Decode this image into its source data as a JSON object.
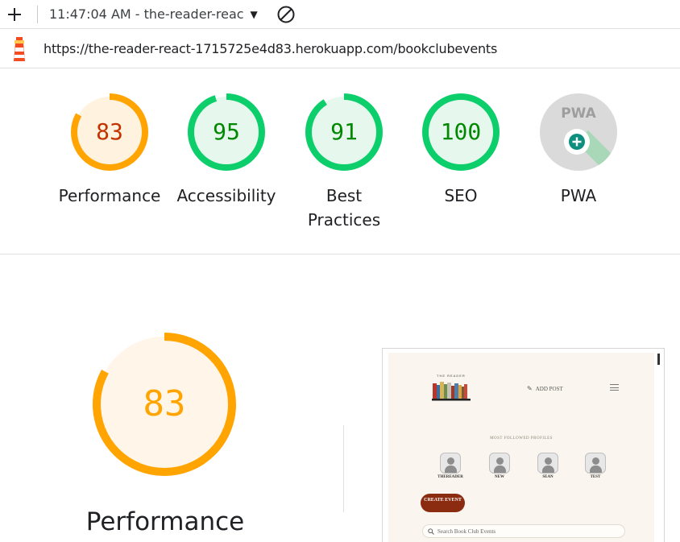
{
  "toolbar": {
    "report_title": "11:47:04 AM - the-reader-reac",
    "icons": {
      "new_report": "plus-icon",
      "dropdown": "caret-down-icon",
      "clear": "block-icon"
    }
  },
  "urlbar": {
    "url": "https://the-reader-react-1715725e4d83.herokuapp.com/bookclubevents",
    "logo_icon": "lighthouse-icon"
  },
  "scores": [
    {
      "id": "performance",
      "label": "Performance",
      "value": 83,
      "fraction": 0.83,
      "ring_color": "#ffa400",
      "bg_color": "#fff3e0",
      "text_color": "#c33300"
    },
    {
      "id": "accessibility",
      "label": "Accessibility",
      "value": 95,
      "fraction": 0.95,
      "ring_color": "#0cce6b",
      "bg_color": "#e6f8ee",
      "text_color": "#008800"
    },
    {
      "id": "best-practices",
      "label_line1": "Best",
      "label_line2": "Practices",
      "value": 91,
      "fraction": 0.91,
      "ring_color": "#0cce6b",
      "bg_color": "#e6f8ee",
      "text_color": "#008800"
    },
    {
      "id": "seo",
      "label": "SEO",
      "value": 100,
      "fraction": 1.0,
      "ring_color": "#0cce6b",
      "bg_color": "#e6f8ee",
      "text_color": "#008800"
    }
  ],
  "pwa": {
    "label": "PWA",
    "badge_text": "PWA",
    "icon": "pwa-badge-icon"
  },
  "main": {
    "score": 83,
    "fraction": 0.83,
    "label": "Performance",
    "ring_color": "#ffa400",
    "text_color": "#ffa400"
  },
  "screenshot": {
    "brand": "THE READER",
    "add_post": "ADD POST",
    "followed_title": "MOST FOLLOWED PROFILES",
    "profiles": [
      "THEREADER",
      "NEW",
      "SEAN",
      "TEST"
    ],
    "create_button": "CREATE EVENT",
    "search_placeholder": "Search Book Club Events"
  }
}
